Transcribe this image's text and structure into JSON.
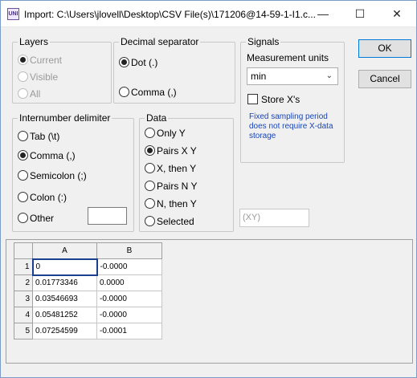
{
  "window": {
    "title": "Import: C:\\Users\\jlovell\\Desktop\\CSV File(s)\\171206@14-59-1-I1.c...",
    "icon": "UNI",
    "minimize": "—",
    "maximize": "☐",
    "close": "✕"
  },
  "layers": {
    "legend": "Layers",
    "options": [
      "Current",
      "Visible",
      "All"
    ],
    "selected": "Current"
  },
  "decimal": {
    "legend": "Decimal separator",
    "options": [
      "Dot (.)",
      "Comma (,)"
    ],
    "selected": "Dot (.)"
  },
  "signals": {
    "legend": "Signals",
    "units_label": "Measurement units",
    "units_value": "min",
    "store_x": "Store X's",
    "store_x_checked": false,
    "info": "Fixed sampling period does not require X-data storage"
  },
  "buttons": {
    "ok": "OK",
    "cancel": "Cancel"
  },
  "delimiter": {
    "legend": "Internumber delimiter",
    "options": [
      "Tab (\\t)",
      "Comma (,)",
      "Semicolon (;)",
      "Colon (:)",
      "Other"
    ],
    "selected": "Comma (,)",
    "other_value": ""
  },
  "data": {
    "legend": "Data",
    "options": [
      "Only Y",
      "Pairs X Y",
      "X, then Y",
      "Pairs N Y",
      "N, then Y",
      "Selected"
    ],
    "selected": "Pairs X Y",
    "selected_value": "(XY)"
  },
  "grid": {
    "columns": [
      "A",
      "B"
    ],
    "rows": [
      {
        "n": "1",
        "a": "0",
        "b": "-0.0000"
      },
      {
        "n": "2",
        "a": "0.01773346",
        "b": "0.0000"
      },
      {
        "n": "3",
        "a": "0.03546693",
        "b": "-0.0000"
      },
      {
        "n": "4",
        "a": "0.05481252",
        "b": "-0.0000"
      },
      {
        "n": "5",
        "a": "0.07254599",
        "b": "-0.0001"
      }
    ]
  },
  "colors": {
    "accent": "#0078d7",
    "info_text": "#1a46b8"
  }
}
